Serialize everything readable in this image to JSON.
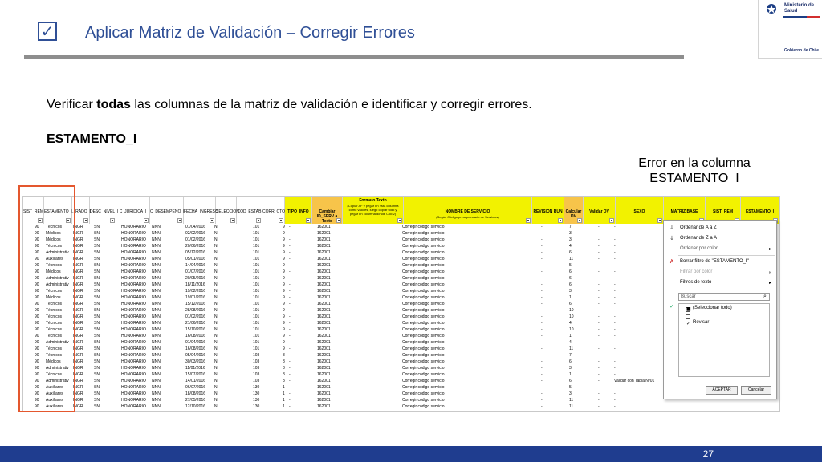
{
  "slide": {
    "title": "Aplicar Matriz de Validación – Corregir Errores",
    "instruction_before": "Verificar ",
    "instruction_bold": "todas",
    "instruction_after": " las columnas de la matriz de validación e identificar y corregir errores.",
    "section": "ESTAMENTO_I",
    "callout_line1": "Error en la columna",
    "callout_line2": "ESTAMENTO_I",
    "page_number": "27",
    "check_glyph": "✓"
  },
  "logo": {
    "line1": "Ministerio de",
    "line2": "Salud",
    "footer": "Gobierno de Chile"
  },
  "colors": {
    "title_blue": "#2f4f96",
    "footer_blue": "#1f3d8f",
    "highlight_frame": "#e4572e",
    "header_yellow": "#f2f200"
  },
  "spreadsheet": {
    "headers": [
      "SIST_REM",
      "ESTAMENTO_I",
      "...RADO_I",
      "DESC_NIVEL_I",
      "C_JURIDICA_I",
      "C_DESEMPENO_I",
      "FECHA_INGRESO",
      "SELECCIÓN",
      "COD_ESTAB",
      "CORR_CTO",
      "TIPO_INFO",
      "Cambiar ID_SERV a Texto",
      "Formato Texto",
      "NOMBRE DE SERVICIO",
      "REVISIÓN RUN",
      "Calcular DV",
      "Validar DV",
      "SEXO",
      "MATRIZ BASE",
      "SIST_REM",
      "ESTAMENTO_I"
    ],
    "formato_note": "(Copiar AF y pegar en esta columna como valores, luego copiar todo y pegar en columna donde Cod 2)",
    "nombre_note": "(Según Código presupuestario de Servicios)",
    "rows": [
      {
        "sist": "90",
        "est": "Técnicos",
        "grado": "INGR",
        "nivel": "SN",
        "jur": "HONORARIO",
        "des": "NNN",
        "fecha": "01/04/2016",
        "sel": "N",
        "cod": "101",
        "corr": "9",
        "tipo": "-",
        "id": "162001",
        "nombre": "Corregir código servicio",
        "run": "-",
        "dv": "7",
        "vdv": "-",
        "sexo": "-"
      },
      {
        "sist": "90",
        "est": "Médicos",
        "grado": "INGR",
        "nivel": "SN",
        "jur": "HONORARIO",
        "des": "NNN",
        "fecha": "02/02/2016",
        "sel": "N",
        "cod": "101",
        "corr": "9",
        "tipo": "-",
        "id": "162001",
        "nombre": "Corregir código servicio",
        "run": "-",
        "dv": "3",
        "vdv": "-",
        "sexo": "-"
      },
      {
        "sist": "90",
        "est": "Médicos",
        "grado": "INGR",
        "nivel": "SN",
        "jur": "HONORARIO",
        "des": "NNN",
        "fecha": "01/02/2016",
        "sel": "N",
        "cod": "101",
        "corr": "9",
        "tipo": "-",
        "id": "162001",
        "nombre": "Corregir código servicio",
        "run": "-",
        "dv": "3",
        "vdv": "-",
        "sexo": "-"
      },
      {
        "sist": "90",
        "est": "Técnicos",
        "grado": "INGR",
        "nivel": "SN",
        "jur": "HONORARIO",
        "des": "NNN",
        "fecha": "20/06/2016",
        "sel": "N",
        "cod": "101",
        "corr": "9",
        "tipo": "-",
        "id": "162001",
        "nombre": "Corregir código servicio",
        "run": "-",
        "dv": "4",
        "vdv": "-",
        "sexo": "-"
      },
      {
        "sist": "90",
        "est": "Administrativ",
        "grado": "INGR",
        "nivel": "SN",
        "jur": "HONORARIO",
        "des": "NNN",
        "fecha": "05/12/2016",
        "sel": "N",
        "cod": "101",
        "corr": "9",
        "tipo": "-",
        "id": "162001",
        "nombre": "Corregir código servicio",
        "run": "-",
        "dv": "6",
        "vdv": "-",
        "sexo": "-"
      },
      {
        "sist": "90",
        "est": "Auxiliares",
        "grado": "INGR",
        "nivel": "SN",
        "jur": "HONORARIO",
        "des": "NNN",
        "fecha": "05/01/2016",
        "sel": "N",
        "cod": "101",
        "corr": "9",
        "tipo": "-",
        "id": "162001",
        "nombre": "Corregir código servicio",
        "run": "-",
        "dv": "11",
        "vdv": "-",
        "sexo": "-"
      },
      {
        "sist": "90",
        "est": "Técnicos",
        "grado": "INGR",
        "nivel": "SN",
        "jur": "HONORARIO",
        "des": "NNN",
        "fecha": "14/04/2016",
        "sel": "N",
        "cod": "101",
        "corr": "9",
        "tipo": "-",
        "id": "162001",
        "nombre": "Corregir código servicio",
        "run": "-",
        "dv": "5",
        "vdv": "-",
        "sexo": "-"
      },
      {
        "sist": "90",
        "est": "Médicos",
        "grado": "INGR",
        "nivel": "SN",
        "jur": "HONORARIO",
        "des": "NNN",
        "fecha": "01/07/2016",
        "sel": "N",
        "cod": "101",
        "corr": "9",
        "tipo": "-",
        "id": "162001",
        "nombre": "Corregir código servicio",
        "run": "-",
        "dv": "6",
        "vdv": "-",
        "sexo": "-"
      },
      {
        "sist": "90",
        "est": "Administrativ",
        "grado": "INGR",
        "nivel": "SN",
        "jur": "HONORARIO",
        "des": "NNN",
        "fecha": "20/05/2016",
        "sel": "N",
        "cod": "101",
        "corr": "9",
        "tipo": "-",
        "id": "162001",
        "nombre": "Corregir código servicio",
        "run": "-",
        "dv": "6",
        "vdv": "-",
        "sexo": "-"
      },
      {
        "sist": "90",
        "est": "Administrativ",
        "grado": "INGR",
        "nivel": "SN",
        "jur": "HONORARIO",
        "des": "NNN",
        "fecha": "18/11/2016",
        "sel": "N",
        "cod": "101",
        "corr": "9",
        "tipo": "-",
        "id": "162001",
        "nombre": "Corregir código servicio",
        "run": "-",
        "dv": "6",
        "vdv": "-",
        "sexo": "-"
      },
      {
        "sist": "90",
        "est": "Técnicos",
        "grado": "INGR",
        "nivel": "SN",
        "jur": "HONORARIO",
        "des": "NNN",
        "fecha": "19/02/2016",
        "sel": "N",
        "cod": "101",
        "corr": "9",
        "tipo": "-",
        "id": "162001",
        "nombre": "Corregir código servicio",
        "run": "-",
        "dv": "3",
        "vdv": "-",
        "sexo": "-"
      },
      {
        "sist": "90",
        "est": "Médicos",
        "grado": "INGR",
        "nivel": "SN",
        "jur": "HONORARIO",
        "des": "NNN",
        "fecha": "19/01/2016",
        "sel": "N",
        "cod": "101",
        "corr": "9",
        "tipo": "-",
        "id": "162001",
        "nombre": "Corregir código servicio",
        "run": "-",
        "dv": "1",
        "vdv": "-",
        "sexo": "-"
      },
      {
        "sist": "90",
        "est": "Técnicos",
        "grado": "INGR",
        "nivel": "SN",
        "jur": "HONORARIO",
        "des": "NNN",
        "fecha": "15/12/2016",
        "sel": "N",
        "cod": "101",
        "corr": "9",
        "tipo": "-",
        "id": "162001",
        "nombre": "Corregir código servicio",
        "run": "-",
        "dv": "6",
        "vdv": "-",
        "sexo": "-"
      },
      {
        "sist": "90",
        "est": "Técnicos",
        "grado": "INGR",
        "nivel": "SN",
        "jur": "HONORARIO",
        "des": "NNN",
        "fecha": "28/08/2016",
        "sel": "N",
        "cod": "101",
        "corr": "9",
        "tipo": "-",
        "id": "162001",
        "nombre": "Corregir código servicio",
        "run": "-",
        "dv": "10",
        "vdv": "-",
        "sexo": "-"
      },
      {
        "sist": "90",
        "est": "Técnicos",
        "grado": "INGR",
        "nivel": "SN",
        "jur": "HONORARIO",
        "des": "NNN",
        "fecha": "01/02/2016",
        "sel": "N",
        "cod": "101",
        "corr": "9",
        "tipo": "-",
        "id": "162001",
        "nombre": "Corregir código servicio",
        "run": "-",
        "dv": "10",
        "vdv": "-",
        "sexo": "-"
      },
      {
        "sist": "90",
        "est": "Técnicos",
        "grado": "INGR",
        "nivel": "SN",
        "jur": "HONORARIO",
        "des": "NNN",
        "fecha": "21/06/2016",
        "sel": "N",
        "cod": "101",
        "corr": "9",
        "tipo": "-",
        "id": "162001",
        "nombre": "Corregir código servicio",
        "run": "-",
        "dv": "4",
        "vdv": "-",
        "sexo": "-"
      },
      {
        "sist": "90",
        "est": "Técnicos",
        "grado": "INGR",
        "nivel": "SN",
        "jur": "HONORARIO",
        "des": "NNN",
        "fecha": "15/10/2016",
        "sel": "N",
        "cod": "101",
        "corr": "9",
        "tipo": "-",
        "id": "162001",
        "nombre": "Corregir código servicio",
        "run": "-",
        "dv": "10",
        "vdv": "-",
        "sexo": "-"
      },
      {
        "sist": "90",
        "est": "Técnicos",
        "grado": "INGR",
        "nivel": "SN",
        "jur": "HONORARIO",
        "des": "NNN",
        "fecha": "16/08/2016",
        "sel": "N",
        "cod": "101",
        "corr": "9",
        "tipo": "-",
        "id": "162001",
        "nombre": "Corregir código servicio",
        "run": "-",
        "dv": "1",
        "vdv": "-",
        "sexo": "-"
      },
      {
        "sist": "90",
        "est": "Administrativ",
        "grado": "INGR",
        "nivel": "SN",
        "jur": "HONORARIO",
        "des": "NNN",
        "fecha": "01/04/2016",
        "sel": "N",
        "cod": "101",
        "corr": "9",
        "tipo": "-",
        "id": "162001",
        "nombre": "Corregir código servicio",
        "run": "-",
        "dv": "4",
        "vdv": "-",
        "sexo": "-"
      },
      {
        "sist": "90",
        "est": "Técnicos",
        "grado": "INGR",
        "nivel": "SN",
        "jur": "HONORARIO",
        "des": "NNN",
        "fecha": "16/08/2016",
        "sel": "N",
        "cod": "101",
        "corr": "9",
        "tipo": "-",
        "id": "162001",
        "nombre": "Corregir código servicio",
        "run": "-",
        "dv": "11",
        "vdv": "-",
        "sexo": "-"
      },
      {
        "sist": "90",
        "est": "Técnicos",
        "grado": "INGR",
        "nivel": "SN",
        "jur": "HONORARIO",
        "des": "NNN",
        "fecha": "05/04/2016",
        "sel": "N",
        "cod": "103",
        "corr": "8",
        "tipo": "-",
        "id": "162001",
        "nombre": "Corregir código servicio",
        "run": "-",
        "dv": "7",
        "vdv": "-",
        "sexo": "-"
      },
      {
        "sist": "90",
        "est": "Médicos",
        "grado": "INGR",
        "nivel": "SN",
        "jur": "HONORARIO",
        "des": "NNN",
        "fecha": "30/03/2016",
        "sel": "N",
        "cod": "103",
        "corr": "8",
        "tipo": "-",
        "id": "162001",
        "nombre": "Corregir código servicio",
        "run": "-",
        "dv": "6",
        "vdv": "-",
        "sexo": "-"
      },
      {
        "sist": "90",
        "est": "Administrativ",
        "grado": "INGR",
        "nivel": "SN",
        "jur": "HONORARIO",
        "des": "NNN",
        "fecha": "11/01/2016",
        "sel": "N",
        "cod": "103",
        "corr": "8",
        "tipo": "-",
        "id": "162001",
        "nombre": "Corregir código servicio",
        "run": "-",
        "dv": "3",
        "vdv": "-",
        "sexo": "-"
      },
      {
        "sist": "90",
        "est": "Técnicos",
        "grado": "INGR",
        "nivel": "SN",
        "jur": "HONORARIO",
        "des": "NNN",
        "fecha": "15/07/2016",
        "sel": "N",
        "cod": "103",
        "corr": "8",
        "tipo": "-",
        "id": "162001",
        "nombre": "Corregir código servicio",
        "run": "-",
        "dv": "1",
        "vdv": "-",
        "sexo": "-"
      },
      {
        "sist": "90",
        "est": "Administrativ",
        "grado": "INGR",
        "nivel": "SN",
        "jur": "HONORARIO",
        "des": "NNN",
        "fecha": "14/01/2016",
        "sel": "N",
        "cod": "103",
        "corr": "8",
        "tipo": "-",
        "id": "162001",
        "nombre": "Corregir código servicio",
        "run": "-",
        "dv": "6",
        "vdv": "-",
        "sexo": "Validar con Tabla Nº01"
      },
      {
        "sist": "90",
        "est": "Auxiliares",
        "grado": "INGR",
        "nivel": "SN",
        "jur": "HONORARIO",
        "des": "NNN",
        "fecha": "06/07/2016",
        "sel": "N",
        "cod": "130",
        "corr": "1",
        "tipo": "-",
        "id": "162001",
        "nombre": "Corregir código servicio",
        "run": "-",
        "dv": "5",
        "vdv": "-",
        "sexo": "-"
      },
      {
        "sist": "90",
        "est": "Auxiliares",
        "grado": "INGR",
        "nivel": "SN",
        "jur": "HONORARIO",
        "des": "NNN",
        "fecha": "18/08/2016",
        "sel": "N",
        "cod": "130",
        "corr": "1",
        "tipo": "-",
        "id": "162001",
        "nombre": "Corregir código servicio",
        "run": "-",
        "dv": "3",
        "vdv": "-",
        "sexo": "-"
      },
      {
        "sist": "90",
        "est": "Auxiliares",
        "grado": "INGR",
        "nivel": "SN",
        "jur": "HONORARIO",
        "des": "NNN",
        "fecha": "27/05/2016",
        "sel": "N",
        "cod": "130",
        "corr": "1",
        "tipo": "-",
        "id": "162001",
        "nombre": "Corregir código servicio",
        "run": "-",
        "dv": "11",
        "vdv": "-",
        "sexo": "-"
      },
      {
        "sist": "90",
        "est": "Auxiliares",
        "grado": "INGR",
        "nivel": "SN",
        "jur": "HONORARIO",
        "des": "NNN",
        "fecha": "12/10/2016",
        "sel": "N",
        "cod": "130",
        "corr": "1",
        "tipo": "-",
        "id": "162001",
        "nombre": "Corregir código servicio",
        "run": "-",
        "dv": "11",
        "vdv": "-",
        "sexo": "-"
      }
    ],
    "last_cell": "Revisar"
  },
  "filter_menu": {
    "sort_asc": "Ordenar de A a Z",
    "sort_desc": "Ordenar de Z a A",
    "sort_color": "Ordenar por color",
    "clear_filter": "Borrar filtro de \"ESTAMENTO_I\"",
    "filter_color": "Filtrar por color",
    "text_filters": "Filtros de texto",
    "search_placeholder": "Buscar",
    "select_all": "(Seleccionar todo)",
    "blank": "",
    "review": "Revisar",
    "ok": "ACEPTAR",
    "cancel": "Cancelar"
  }
}
